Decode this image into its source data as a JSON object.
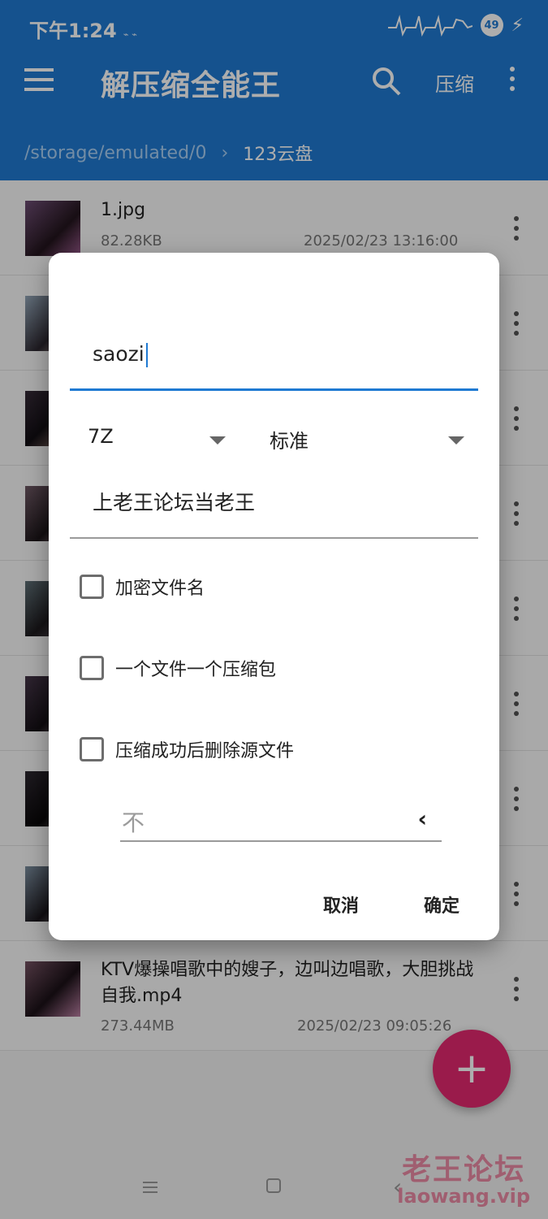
{
  "status_bar": {
    "time": "下午1:24",
    "battery": "49"
  },
  "app_bar": {
    "title": "解压缩全能王",
    "compress_label": "压缩",
    "breadcrumb": {
      "path": "/storage/emulated/0",
      "separator": "›",
      "current": "123云盘"
    }
  },
  "files": [
    {
      "name": "1.jpg",
      "size": "82.28KB",
      "date": "2025/02/23 13:16:00"
    },
    {
      "name": "",
      "size": "",
      "date": ""
    },
    {
      "name": "",
      "size": "",
      "date": ""
    },
    {
      "name": "",
      "size": "",
      "date": ""
    },
    {
      "name": "",
      "size": "",
      "date": ""
    },
    {
      "name": "",
      "size": "",
      "date": ""
    },
    {
      "name": "",
      "size": "",
      "date": ""
    },
    {
      "name": "",
      "size": "",
      "date": ""
    },
    {
      "name": "KTV爆操唱歌中的嫂子，边叫边唱歌，大胆挑战自我.mp4",
      "size": "273.44MB",
      "date": "2025/02/23 09:05:26"
    }
  ],
  "dialog": {
    "archive_name": "saozi",
    "format": "7Z",
    "level": "标准",
    "password": "上老王论坛当老王",
    "options": [
      {
        "label": "加密文件名",
        "checked": false
      },
      {
        "label": "一个文件一个压缩包",
        "checked": false
      },
      {
        "label": "压缩成功后删除源文件",
        "checked": false
      }
    ],
    "split_value": "不",
    "cancel_label": "取消",
    "ok_label": "确定"
  },
  "fab": "+",
  "watermark": {
    "line1": "老王论坛",
    "line2": "laowang.vip"
  },
  "colors": {
    "primary": "#1f7ad2",
    "fab": "#e4286f"
  }
}
